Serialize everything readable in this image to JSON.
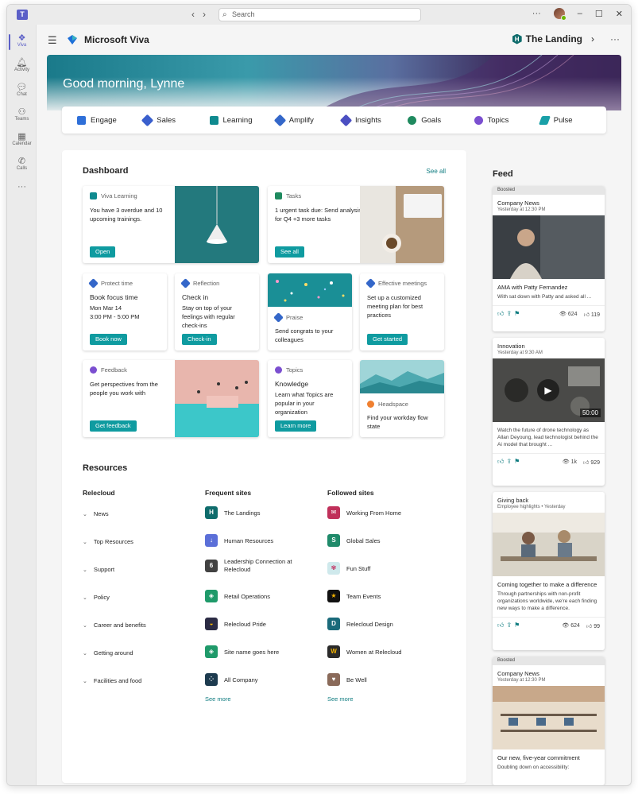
{
  "titlebar": {
    "search_placeholder": "Search"
  },
  "rail": [
    {
      "label": "Viva",
      "icon": "viva-icon"
    },
    {
      "label": "Activity",
      "icon": "bell-icon"
    },
    {
      "label": "Chat",
      "icon": "chat-icon"
    },
    {
      "label": "Teams",
      "icon": "teams-icon"
    },
    {
      "label": "Calendar",
      "icon": "calendar-icon"
    },
    {
      "label": "Calls",
      "icon": "phone-icon"
    }
  ],
  "header": {
    "app_title": "Microsoft Viva",
    "site_name": "The Landing",
    "site_badge": "H"
  },
  "hero": {
    "greeting": "Good morning, Lynne"
  },
  "apps": [
    {
      "label": "Engage",
      "color": "#2e6fd8"
    },
    {
      "label": "Sales",
      "color": "#3a5fcd"
    },
    {
      "label": "Learning",
      "color": "#0f8a8f"
    },
    {
      "label": "Amplify",
      "color": "#3467c9"
    },
    {
      "label": "Insights",
      "color": "#4b4fc2"
    },
    {
      "label": "Goals",
      "color": "#1f8a5f"
    },
    {
      "label": "Topics",
      "color": "#7b4fd0"
    },
    {
      "label": "Pulse",
      "color": "#1aa0a8"
    }
  ],
  "dashboard": {
    "title": "Dashboard",
    "see_all": "See all",
    "learning": {
      "source": "Viva Learning",
      "text": "You have 3 overdue and 10 upcoming trainings.",
      "button": "Open"
    },
    "tasks": {
      "source": "Tasks",
      "text": "1 urgent task due: Send analysis for Q4 +3 more tasks",
      "button": "See all"
    },
    "protect": {
      "source": "Protect time",
      "title": "Book focus time",
      "line1": "Mon Mar 14",
      "line2": "3:00 PM - 5:00 PM",
      "button": "Book now"
    },
    "reflection": {
      "source": "Reflection",
      "title": "Check in",
      "text": "Stay on top of your feelings with regular check-ins",
      "button": "Check-in"
    },
    "praise": {
      "source": "Praise",
      "text": "Send congrats to your colleagues"
    },
    "meetings": {
      "source": "Effective meetings",
      "text": "Set up a customized meeting plan for best practices",
      "button": "Get started"
    },
    "feedback": {
      "source": "Feedback",
      "text": "Get perspectives from the people you work with",
      "button": "Get feedback"
    },
    "topics": {
      "source": "Topics",
      "title": "Knowledge",
      "text": "Learn what Topics are popular in your organization",
      "button": "Learn more"
    },
    "headspace": {
      "source": "Headspace",
      "text": "Find your workday flow state"
    }
  },
  "resources": {
    "title": "Resources",
    "relecloud": {
      "heading": "Relecloud",
      "items": [
        "News",
        "Top Resources",
        "Support",
        "Policy",
        "Career and benefits",
        "Getting around",
        "Facilities and food"
      ]
    },
    "frequent": {
      "heading": "Frequent sites",
      "see_more": "See more",
      "items": [
        {
          "label": "The Landings",
          "color": "#0f6c6c",
          "glyph": "H"
        },
        {
          "label": "Human Resources",
          "color": "#5b6fd8",
          "glyph": ""
        },
        {
          "label": "Leadership Connection at Relecloud",
          "color": "#424242",
          "glyph": ""
        },
        {
          "label": "Retail Operations",
          "color": "#1f9a6a",
          "glyph": ""
        },
        {
          "label": "Relecloud Pride",
          "color": "#2b2b44",
          "glyph": ""
        },
        {
          "label": "Site name goes here",
          "color": "#1f9a6a",
          "glyph": ""
        },
        {
          "label": "All Company",
          "color": "#1d3b4f",
          "glyph": ""
        }
      ]
    },
    "followed": {
      "heading": "Followed sites",
      "see_more": "See more",
      "items": [
        {
          "label": "Working From Home",
          "color": "#c0305a"
        },
        {
          "label": "Global Sales",
          "color": "#1f8a6a"
        },
        {
          "label": "Fun Stuff",
          "color": "#5ab0b8"
        },
        {
          "label": "Team Events",
          "color": "#111111"
        },
        {
          "label": "Relecloud Design",
          "color": "#1a6a7a"
        },
        {
          "label": "Women at Relecloud",
          "color": "#2a2a2a"
        },
        {
          "label": "Be Well",
          "color": "#8a6a5a"
        }
      ]
    }
  },
  "feed": {
    "title": "Feed",
    "posts": [
      {
        "boosted": "Boosted",
        "source": "Company News",
        "time": "Yesterday at 12:30 PM",
        "headline": "AMA with Patty Fernandez",
        "desc": "With sat down with Patty and asked all ...",
        "views": "624",
        "reactions": "119"
      },
      {
        "source": "Innovation",
        "time": "Yesterday at 9:30 AM",
        "duration": "50:00",
        "headline": "",
        "desc": "Watch the future of drone technology as Allan Deyoung, lead technologist behind the Ai model that brought ...",
        "views": "1k",
        "reactions": "929"
      },
      {
        "source": "Giving back",
        "time": "Employee highlights • Yesterday",
        "headline": "Coming together to make a difference",
        "desc": "Through partnerships with non-profit organizations worldwide, we're each finding new ways to make a difference.",
        "views": "624",
        "reactions": "99"
      },
      {
        "boosted": "Boosted",
        "source": "Company News",
        "time": "Yesterday at 12:30 PM",
        "headline": "Our new, five-year commitment",
        "desc": "Doubling down on accessibility:"
      }
    ]
  }
}
